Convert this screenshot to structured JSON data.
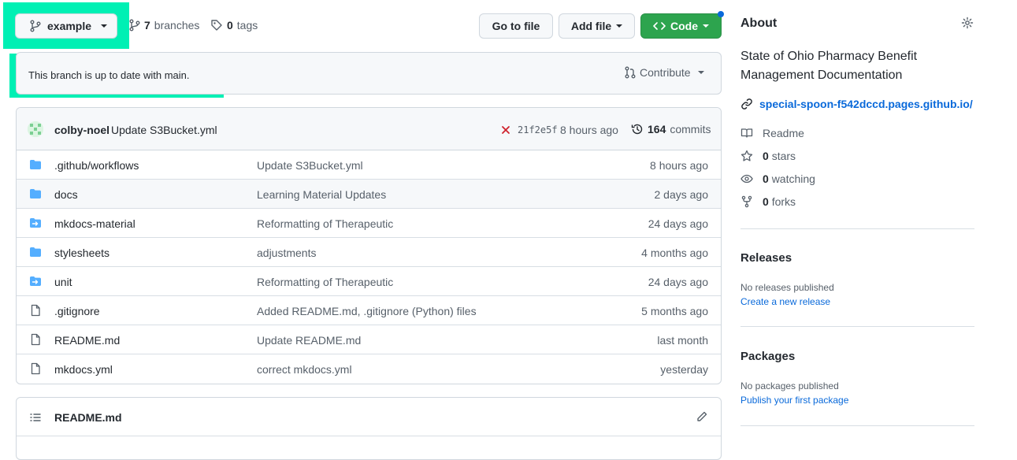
{
  "top": {
    "branch_label": "example",
    "branches_count": "7",
    "branches_label": "branches",
    "tags_count": "0",
    "tags_label": "tags",
    "go_to_file": "Go to file",
    "add_file": "Add file",
    "code": "Code"
  },
  "status": {
    "text": "This branch is up to date with main.",
    "contribute": "Contribute"
  },
  "commit": {
    "author": "colby-noel",
    "message": "Update S3Bucket.yml",
    "sha": "21f2e5f",
    "time": "8 hours ago",
    "commits_count": "164",
    "commits_label": "commits"
  },
  "files": [
    {
      "name": ".github/workflows",
      "message": "Update S3Bucket.yml",
      "age": "8 hours ago",
      "icon": "folder-icon"
    },
    {
      "name": "docs",
      "message": "Learning Material Updates",
      "age": "2 days ago",
      "icon": "folder-icon"
    },
    {
      "name": "mkdocs-material",
      "message": "Reformatting of Therapeutic",
      "age": "24 days ago",
      "icon": "submodule-icon"
    },
    {
      "name": "stylesheets",
      "message": "adjustments",
      "age": "4 months ago",
      "icon": "folder-icon"
    },
    {
      "name": "unit",
      "message": "Reformatting of Therapeutic",
      "age": "24 days ago",
      "icon": "submodule-icon"
    },
    {
      "name": ".gitignore",
      "message": "Added README.md, .gitignore (Python) files",
      "age": "5 months ago",
      "icon": "file-icon"
    },
    {
      "name": "README.md",
      "message": "Update README.md",
      "age": "last month",
      "icon": "file-icon"
    },
    {
      "name": "mkdocs.yml",
      "message": "correct mkdocs.yml",
      "age": "yesterday",
      "icon": "file-icon"
    }
  ],
  "readme": {
    "title": "README.md"
  },
  "about": {
    "title": "About",
    "description_line1": "State of Ohio Pharmacy Benefit",
    "description_line2": "Management Documentation",
    "link": "special-spoon-f542dccd.pages.github.io/",
    "readme": "Readme",
    "stars_count": "0",
    "stars_label": "stars",
    "watching_count": "0",
    "watching_label": "watching",
    "forks_count": "0",
    "forks_label": "forks"
  },
  "releases": {
    "title": "Releases",
    "none": "No releases published",
    "create": "Create a new release"
  },
  "packages": {
    "title": "Packages",
    "none": "No packages published",
    "publish": "Publish your first package"
  },
  "colors": {
    "highlight": "#00f0b4",
    "code_button": "#2da44e",
    "link": "#0969da",
    "folder": "#54aeff",
    "error_x": "#cf222e"
  }
}
